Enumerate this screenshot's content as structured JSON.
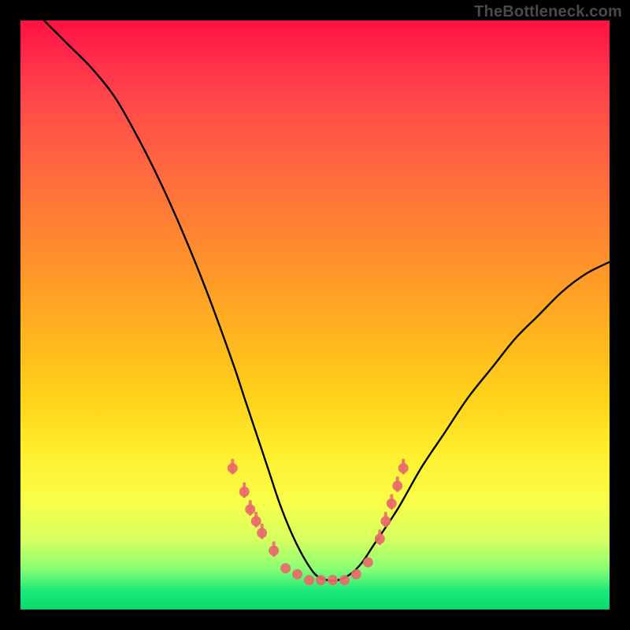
{
  "watermark": {
    "text": "TheBottleneck.com"
  },
  "colors": {
    "background": "#000000",
    "curve": "#000000",
    "marker_fill": "#e86a6a",
    "marker_stroke": "#d85a5a"
  },
  "chart_data": {
    "type": "line",
    "title": "",
    "xlabel": "",
    "ylabel": "",
    "xlim": [
      0,
      100
    ],
    "ylim": [
      0,
      100
    ],
    "grid": false,
    "legend": false,
    "note": "Axes are implicit (no tick labels in image). x/y values are read as percent of plot area: x left→right, y bottom→top. Curve depicts a V-shaped bottleneck curve with minimum near x≈51.",
    "series": [
      {
        "name": "bottleneck-curve",
        "x": [
          4,
          8,
          12,
          16,
          20,
          24,
          28,
          32,
          36,
          38,
          40,
          42,
          44,
          46,
          48,
          50,
          52,
          54,
          56,
          58,
          60,
          64,
          68,
          72,
          76,
          80,
          84,
          88,
          92,
          96,
          100
        ],
        "y": [
          100,
          96,
          92,
          87,
          80,
          72,
          63,
          53,
          42,
          36,
          30,
          24,
          18,
          13,
          9,
          6,
          5,
          5,
          6,
          8,
          11,
          17,
          24,
          30,
          36,
          41,
          46,
          50,
          54,
          57,
          59
        ]
      }
    ],
    "markers": {
      "name": "highlighted-range",
      "note": "Salmon dot/tick markers clustered around the trough of the curve.",
      "points": [
        {
          "x": 36,
          "y": 24
        },
        {
          "x": 38,
          "y": 20
        },
        {
          "x": 39,
          "y": 17
        },
        {
          "x": 40,
          "y": 15
        },
        {
          "x": 41,
          "y": 13
        },
        {
          "x": 43,
          "y": 10
        },
        {
          "x": 45,
          "y": 7
        },
        {
          "x": 47,
          "y": 6
        },
        {
          "x": 49,
          "y": 5
        },
        {
          "x": 51,
          "y": 5
        },
        {
          "x": 53,
          "y": 5
        },
        {
          "x": 55,
          "y": 5
        },
        {
          "x": 57,
          "y": 6
        },
        {
          "x": 59,
          "y": 8
        },
        {
          "x": 61,
          "y": 12
        },
        {
          "x": 62,
          "y": 15
        },
        {
          "x": 63,
          "y": 18
        },
        {
          "x": 64,
          "y": 21
        },
        {
          "x": 65,
          "y": 24
        }
      ]
    }
  }
}
